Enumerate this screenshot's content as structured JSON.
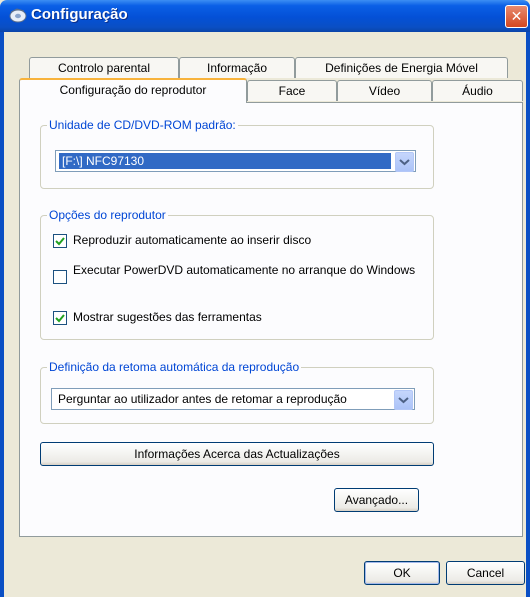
{
  "window": {
    "title": "Configuração"
  },
  "tabs_row1": [
    "Controlo parental",
    "Informação",
    "Definições de Energia Móvel"
  ],
  "tabs_row2": [
    "Configuração do reprodutor",
    "Face",
    "Vídeo",
    "Áudio"
  ],
  "drive_group": {
    "label": "Unidade de CD/DVD-ROM padrão:",
    "selected": "[F:\\] NFC97130"
  },
  "player_options": {
    "label": "Opções do reprodutor",
    "items": [
      {
        "label": "Reproduzir automaticamente ao inserir disco",
        "checked": true
      },
      {
        "label": "Executar PowerDVD automaticamente no arranque do Windows",
        "checked": false
      },
      {
        "label": "Mostrar sugestões das ferramentas",
        "checked": true
      }
    ]
  },
  "resume_group": {
    "label": "Definição da retoma automática da reprodução",
    "selected": "Perguntar ao utilizador antes de retomar a reprodução"
  },
  "buttons": {
    "updates": "Informações Acerca das Actualizações",
    "advanced": "Avançado...",
    "ok": "OK",
    "cancel": "Cancel"
  }
}
